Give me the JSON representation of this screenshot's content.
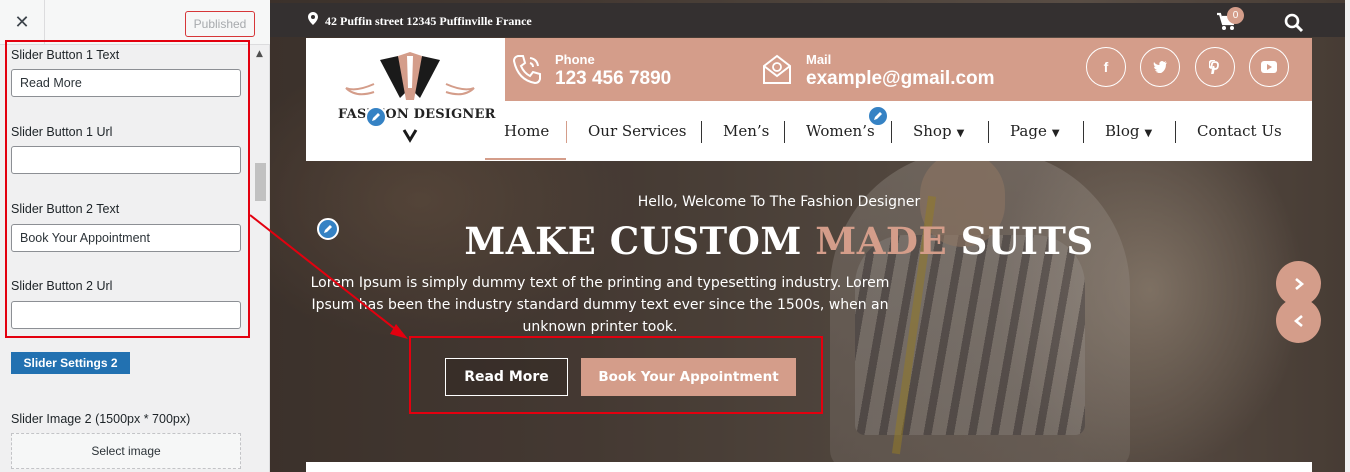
{
  "customizer": {
    "close_icon": "close-icon",
    "published_label": "Published",
    "fields": [
      {
        "label": "Slider Button 1 Text",
        "value": "Read More"
      },
      {
        "label": "Slider Button 1 Url",
        "value": ""
      },
      {
        "label": "Slider Button 2 Text",
        "value": "Book Your Appointment"
      },
      {
        "label": "Slider Button 2 Url",
        "value": ""
      }
    ],
    "section_button": "Slider Settings 2",
    "image_label": "Slider Image 2 (1500px * 700px)",
    "select_image": "Select image"
  },
  "topbar": {
    "address": "42 Puffin street 12345 Puffinville France",
    "cart_count": "0"
  },
  "header": {
    "logo_text": "FASHION DESIGNER",
    "phone_label": "Phone",
    "phone_value": "123 456 7890",
    "mail_label": "Mail",
    "mail_value": "example@gmail.com",
    "social": [
      "f",
      "t",
      "p",
      "yt"
    ]
  },
  "nav": {
    "items": [
      "Home",
      "Our Services",
      "Men’s",
      "Women’s",
      "Shop",
      "Page",
      "Blog",
      "Contact Us"
    ]
  },
  "hero": {
    "welcome": "Hello, Welcome To The Fashion Designer",
    "title_part1": "MAKE CUSTOM",
    "title_accent": "MADE",
    "title_part2": "SUITS",
    "description": "Lorem Ipsum is simply dummy text of the printing and typesetting industry. Lorem Ipsum has been the industry standard dummy text ever since the 1500s, when an unknown printer took.",
    "button1": "Read More",
    "button2": "Book Your Appointment"
  },
  "colors": {
    "accent": "#d49d8a",
    "wp_blue": "#2271b1",
    "highlight_red": "#e3000f",
    "topbar": "#343030"
  }
}
